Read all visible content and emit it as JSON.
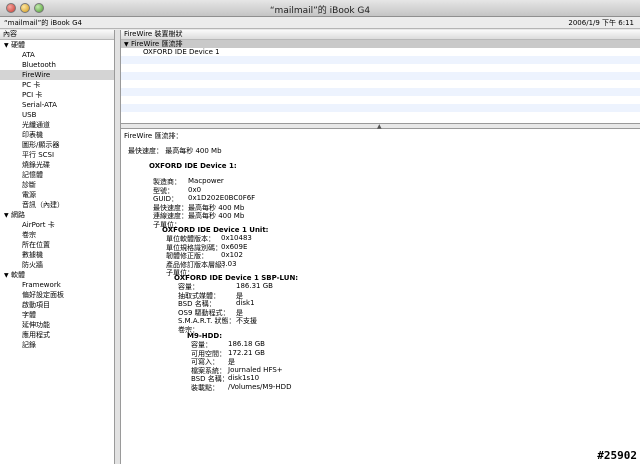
{
  "window": {
    "title": "“mailmail”的 iBook G4"
  },
  "toolbar": {
    "machine": "“mailmail”的 iBook G4",
    "datetime": "2006/1/9 下午 6:11"
  },
  "sidebar": {
    "header": "內容",
    "tree": [
      {
        "kind": "cat",
        "label": "硬體"
      },
      {
        "kind": "child",
        "label": "ATA"
      },
      {
        "kind": "child",
        "label": "Bluetooth"
      },
      {
        "kind": "child",
        "label": "FireWire",
        "selected": true
      },
      {
        "kind": "child",
        "label": "PC 卡"
      },
      {
        "kind": "child",
        "label": "PCI 卡"
      },
      {
        "kind": "child",
        "label": "Serial-ATA"
      },
      {
        "kind": "child",
        "label": "USB"
      },
      {
        "kind": "child",
        "label": "光纖通道"
      },
      {
        "kind": "child",
        "label": "印表機"
      },
      {
        "kind": "child",
        "label": "圖形/顯示器"
      },
      {
        "kind": "child",
        "label": "平行 SCSI"
      },
      {
        "kind": "child",
        "label": "燒錄光碟"
      },
      {
        "kind": "child",
        "label": "記憶體"
      },
      {
        "kind": "child",
        "label": "診斷"
      },
      {
        "kind": "child",
        "label": "電源"
      },
      {
        "kind": "child",
        "label": "音訊（內建）"
      },
      {
        "kind": "cat",
        "label": "網路"
      },
      {
        "kind": "child",
        "label": "AirPort 卡"
      },
      {
        "kind": "child",
        "label": "卷宗"
      },
      {
        "kind": "child",
        "label": "所在位置"
      },
      {
        "kind": "child",
        "label": "數據機"
      },
      {
        "kind": "child",
        "label": "防火牆"
      },
      {
        "kind": "cat",
        "label": "軟體"
      },
      {
        "kind": "child",
        "label": "Framework"
      },
      {
        "kind": "child",
        "label": "偏好設定面板"
      },
      {
        "kind": "child",
        "label": "啟動項目"
      },
      {
        "kind": "child",
        "label": "字體"
      },
      {
        "kind": "child",
        "label": "延伸功能"
      },
      {
        "kind": "child",
        "label": "應用程式"
      },
      {
        "kind": "child",
        "label": "記錄"
      }
    ]
  },
  "devices": {
    "header": "FireWire 裝置樹狀",
    "bus": "FireWire 匯流排",
    "item": "OXFORD IDE Device 1"
  },
  "detail": {
    "bus_title": "FireWire 匯流排：",
    "max_speed": "最快速度： 最高每秒 400 Mb",
    "device_title": "OXFORD IDE Device 1:",
    "device_rows": [
      {
        "k": "製造商：",
        "v": "Macpower"
      },
      {
        "k": "型號：",
        "v": "0x0"
      },
      {
        "k": "GUID：",
        "v": "0x1D202E0BC0F6F"
      },
      {
        "k": "最快速度：",
        "v": "最高每秒 400 Mb"
      },
      {
        "k": "連線速度：",
        "v": "最高每秒 400 Mb"
      },
      {
        "k": "子單位：",
        "v": ""
      }
    ],
    "unit_title": "OXFORD IDE Device 1 Unit:",
    "unit_rows": [
      {
        "k": "單位軟體版本：",
        "v": "0x10483"
      },
      {
        "k": "單位規格識別碼：",
        "v": "0x609E"
      },
      {
        "k": "韌體修正版：",
        "v": "0x102"
      },
      {
        "k": "產品修訂版本層級：",
        "v": "3.03"
      },
      {
        "k": "子單位：",
        "v": ""
      }
    ],
    "lun_title": "OXFORD IDE Device 1 SBP-LUN:",
    "lun_rows": [
      {
        "k": "容量：",
        "v": "186.31 GB"
      },
      {
        "k": "抽取式媒體：",
        "v": "是"
      },
      {
        "k": "BSD 名稱：",
        "v": "disk1"
      },
      {
        "k": "OS9 驅動程式：",
        "v": "是"
      },
      {
        "k": "S.M.A.R.T. 狀態：",
        "v": "不支援"
      },
      {
        "k": "卷宗：",
        "v": ""
      }
    ],
    "vol_title": "M9-HDD:",
    "vol_rows": [
      {
        "k": "容量：",
        "v": "186.18 GB"
      },
      {
        "k": "可用空間：",
        "v": "172.21 GB"
      },
      {
        "k": "可寫入：",
        "v": "是"
      },
      {
        "k": "檔案系統：",
        "v": "Journaled HFS+"
      },
      {
        "k": "BSD 名稱：",
        "v": "disk1s10"
      },
      {
        "k": "裝載點：",
        "v": "/Volumes/M9-HDD"
      }
    ]
  },
  "watermark": "#25902"
}
